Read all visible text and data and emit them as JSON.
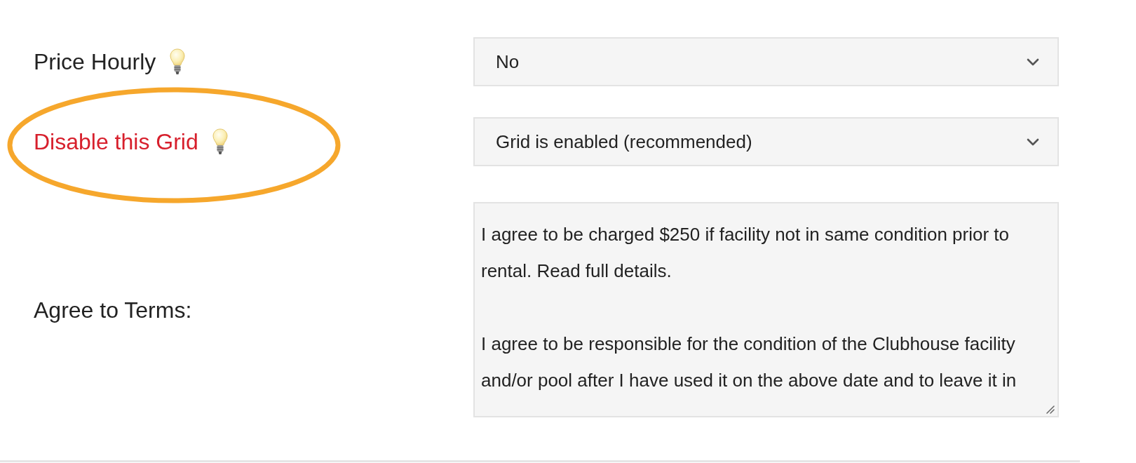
{
  "form": {
    "rows": [
      {
        "label": "Price Hourly",
        "color": "#222222",
        "tip": true,
        "highlighted": false,
        "field": {
          "kind": "select",
          "value": "No"
        }
      },
      {
        "label": "Disable this Grid",
        "color": "#d71f2c",
        "tip": true,
        "highlighted": true,
        "field": {
          "kind": "select",
          "value": "Grid is enabled (recommended)"
        }
      },
      {
        "label": "Agree to Terms:",
        "color": "#222222",
        "tip": false,
        "highlighted": false,
        "field": {
          "kind": "textarea",
          "value": "I agree to be charged $250 if facility not in same condition prior to rental. Read full details.\n\nI agree to be responsible for the condition of the Clubhouse facility and/or pool after I have used it on the above date and to leave it in"
        }
      }
    ]
  }
}
